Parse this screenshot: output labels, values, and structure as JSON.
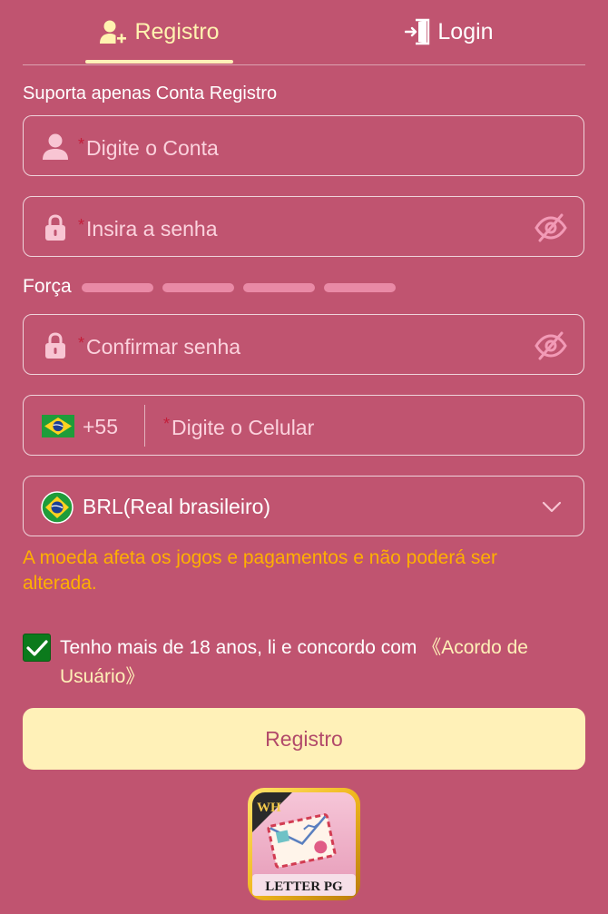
{
  "tabs": {
    "register_label": "Registro",
    "login_label": "Login",
    "active": "register",
    "register_icon": "user-plus-icon",
    "login_icon": "login-door-icon"
  },
  "form": {
    "note": "Suporta apenas Conta Registro",
    "required_mark": "*",
    "account": {
      "placeholder": "Digite o Conta",
      "icon": "user-icon"
    },
    "password": {
      "placeholder": "Insira a senha",
      "icon": "lock-icon",
      "toggle_icon": "eye-off-icon"
    },
    "strength": {
      "label": "Força",
      "segments": 4,
      "level": 0
    },
    "confirm": {
      "placeholder": "Confirmar senha",
      "icon": "lock-icon",
      "toggle_icon": "eye-off-icon"
    },
    "phone": {
      "country_code": "+55",
      "placeholder": "Digite o Celular",
      "flag": "brazil-flag-icon"
    },
    "currency": {
      "value": "BRL(Real brasileiro)",
      "icon": "brazil-coin-icon"
    },
    "currency_warning": "A moeda afeta os jogos e pagamentos e não poderá ser alterada.",
    "agreement": {
      "checked": true,
      "text": "Tenho mais de 18 anos, li e concordo com ",
      "link": "《Acordo de Usuário》"
    },
    "submit_label": "Registro"
  },
  "app_logo": {
    "text": "LETTER PG",
    "badge": "WH"
  },
  "colors": {
    "background": "#c05470",
    "accent": "#fff1b8",
    "warning": "#ffb000",
    "checkbox": "#0b7a1c",
    "required": "#c41e3a"
  }
}
